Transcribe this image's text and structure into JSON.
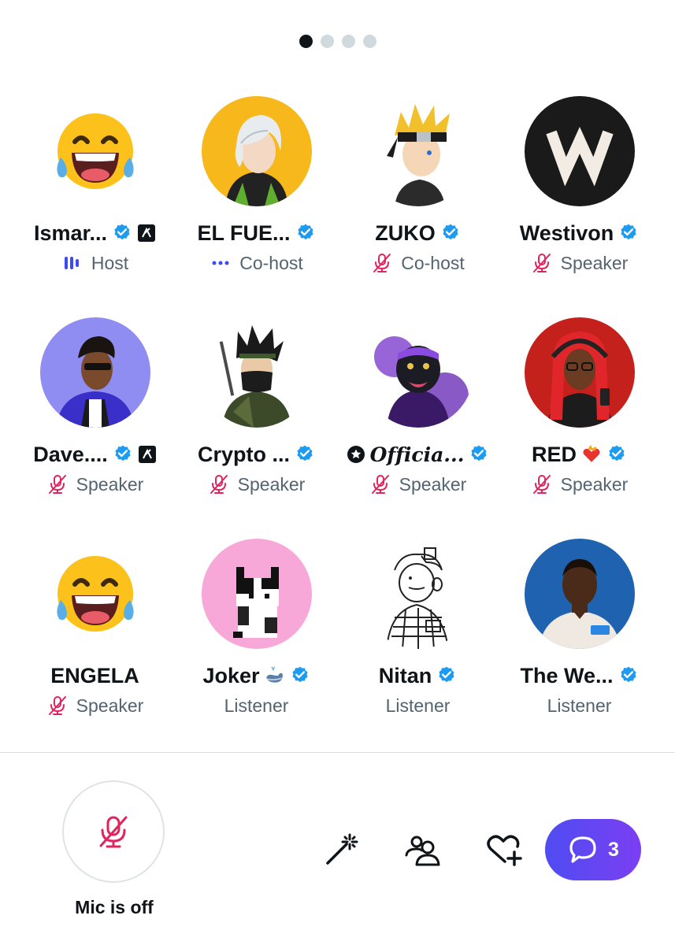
{
  "pagination": {
    "pages": 4,
    "active": 0
  },
  "participants": [
    {
      "name": "Ismar...",
      "role": "Host",
      "role_icon": "speaking-bars-icon",
      "verified": true,
      "affiliate": true,
      "avatar": "laughing-emoji"
    },
    {
      "name": "EL FUE...",
      "role": "Co-host",
      "role_icon": "dots-icon",
      "verified": true,
      "affiliate": false,
      "avatar": "anime-white-hair"
    },
    {
      "name": "ZUKO",
      "role": "Co-host",
      "role_icon": "mic-off-icon",
      "verified": true,
      "affiliate": false,
      "avatar": "anime-ninja-blonde"
    },
    {
      "name": "Westivon",
      "role": "Speaker",
      "role_icon": "mic-off-icon",
      "verified": true,
      "affiliate": false,
      "avatar": "w-logo"
    },
    {
      "name": "Dave....",
      "role": "Speaker",
      "role_icon": "mic-off-icon",
      "verified": true,
      "affiliate": true,
      "avatar": "man-sunglasses"
    },
    {
      "name": "Crypto ...",
      "role": "Speaker",
      "role_icon": "mic-off-icon",
      "verified": true,
      "affiliate": false,
      "avatar": "masked-ninja"
    },
    {
      "name": "𝑶𝒇𝒇𝒊𝒄𝒊𝒂...",
      "role": "Speaker",
      "role_icon": "mic-off-icon",
      "verified": true,
      "affiliate": false,
      "avatar": "purple-panther",
      "prefix_icon": "star-circle-icon"
    },
    {
      "name": "RED",
      "role": "Speaker",
      "role_icon": "mic-off-icon",
      "verified": true,
      "affiliate": false,
      "avatar": "red-hair-woman",
      "suffix_emoji": "heart-on-fire-emoji"
    },
    {
      "name": "ENGELA",
      "role": "Speaker",
      "role_icon": "mic-off-icon",
      "verified": false,
      "affiliate": false,
      "avatar": "laughing-emoji"
    },
    {
      "name": "Joker",
      "role": "Listener",
      "role_icon": "",
      "verified": true,
      "affiliate": false,
      "avatar": "pixel-cat",
      "suffix_emoji": "whale-emoji"
    },
    {
      "name": "Nitan",
      "role": "Listener",
      "role_icon": "",
      "verified": true,
      "affiliate": false,
      "avatar": "sketch-character"
    },
    {
      "name": "The We...",
      "role": "Listener",
      "role_icon": "",
      "verified": true,
      "affiliate": false,
      "avatar": "man-web3-shirt"
    }
  ],
  "controls": {
    "mic_label": "Mic is off",
    "mic_icon": "mic-off-icon",
    "tools": [
      "magic-wand-icon",
      "people-icon",
      "heart-plus-icon"
    ],
    "chat_count": "3",
    "chat_icon": "chat-bubble-icon"
  },
  "colors": {
    "verified": "#1d9bf0",
    "mic_off": "#e0245e",
    "host_accent": "#3b4cf5",
    "chat_gradient_start": "#4f4cf2",
    "chat_gradient_end": "#7b3ff2",
    "secondary_text": "#536471"
  }
}
